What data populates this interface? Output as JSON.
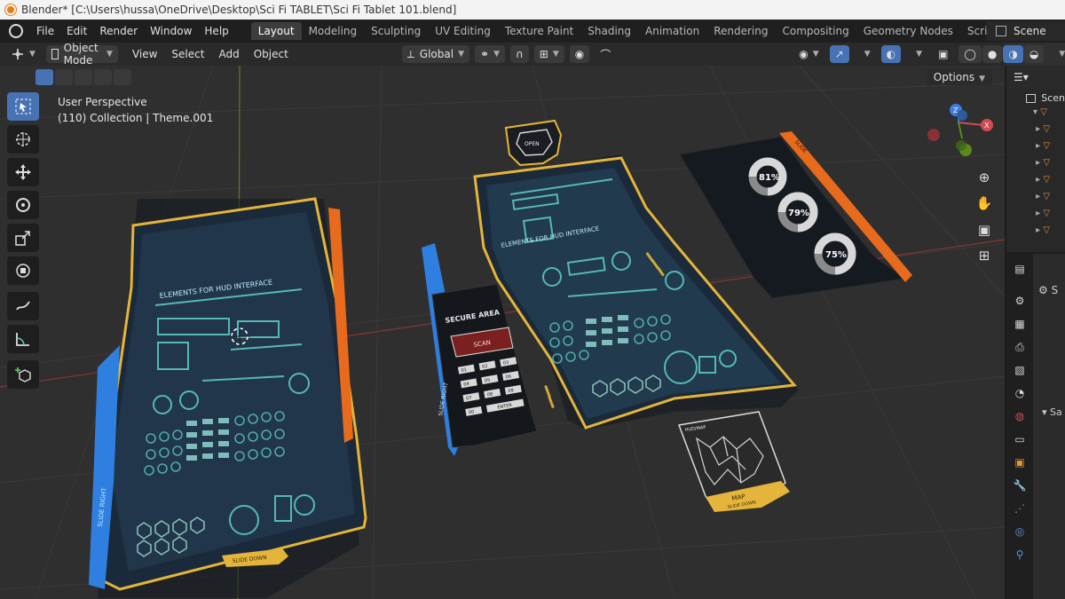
{
  "window": {
    "title": "Blender* [C:\\Users\\hussa\\OneDrive\\Desktop\\Sci Fi TABLET\\Sci Fi Tablet 101.blend]"
  },
  "menu": [
    "File",
    "Edit",
    "Render",
    "Window",
    "Help"
  ],
  "workspaces": [
    "Layout",
    "Modeling",
    "Sculpting",
    "UV Editing",
    "Texture Paint",
    "Shading",
    "Animation",
    "Rendering",
    "Compositing",
    "Geometry Nodes",
    "Scripting"
  ],
  "active_workspace": "Layout",
  "scene": {
    "label": "Scene"
  },
  "viewport_header": {
    "mode": "Object Mode",
    "menus": [
      "View",
      "Select",
      "Add",
      "Object"
    ],
    "orientation": "Global",
    "options": "Options"
  },
  "viewport": {
    "perspective": "User Perspective",
    "collection": "(110) Collection | Theme.001"
  },
  "hud": {
    "tablet_left_header": "ELEMENTS FOR HUD INTERFACE",
    "tablet_left_side": "SLIDE RIGHT",
    "tablet_left_footer": "SLIDE DOWN",
    "tablet_center_header": "ELEMENTS FOR HUD INTERFACE",
    "badge": "OPEN",
    "keypad_title": "SECURE AREA",
    "keypad_screen": "SCAN",
    "keypad_side": "SLIDE RIGHT",
    "keypad_enter": "ENTER",
    "keypad_keys": [
      "01",
      "02",
      "03",
      "04",
      "05",
      "06",
      "07",
      "08",
      "09",
      "00"
    ],
    "stats": [
      "81%",
      "79%",
      "75%"
    ],
    "stats_tag": "SLIDE",
    "map_header": "HUD/MAP",
    "map_label": "MAP",
    "map_footer": "SLIDE DOWN"
  },
  "outliner": {
    "scene_label": "Scen"
  },
  "colors": {
    "accent_blue": "#4772b3",
    "hud_yellow": "#e4b53a",
    "hud_orange": "#e86a1c",
    "hud_blue": "#2f7fe0",
    "hud_cyan": "#5fd0c7",
    "axis_red": "#9a3b3b",
    "axis_green": "#6b8a2c"
  }
}
